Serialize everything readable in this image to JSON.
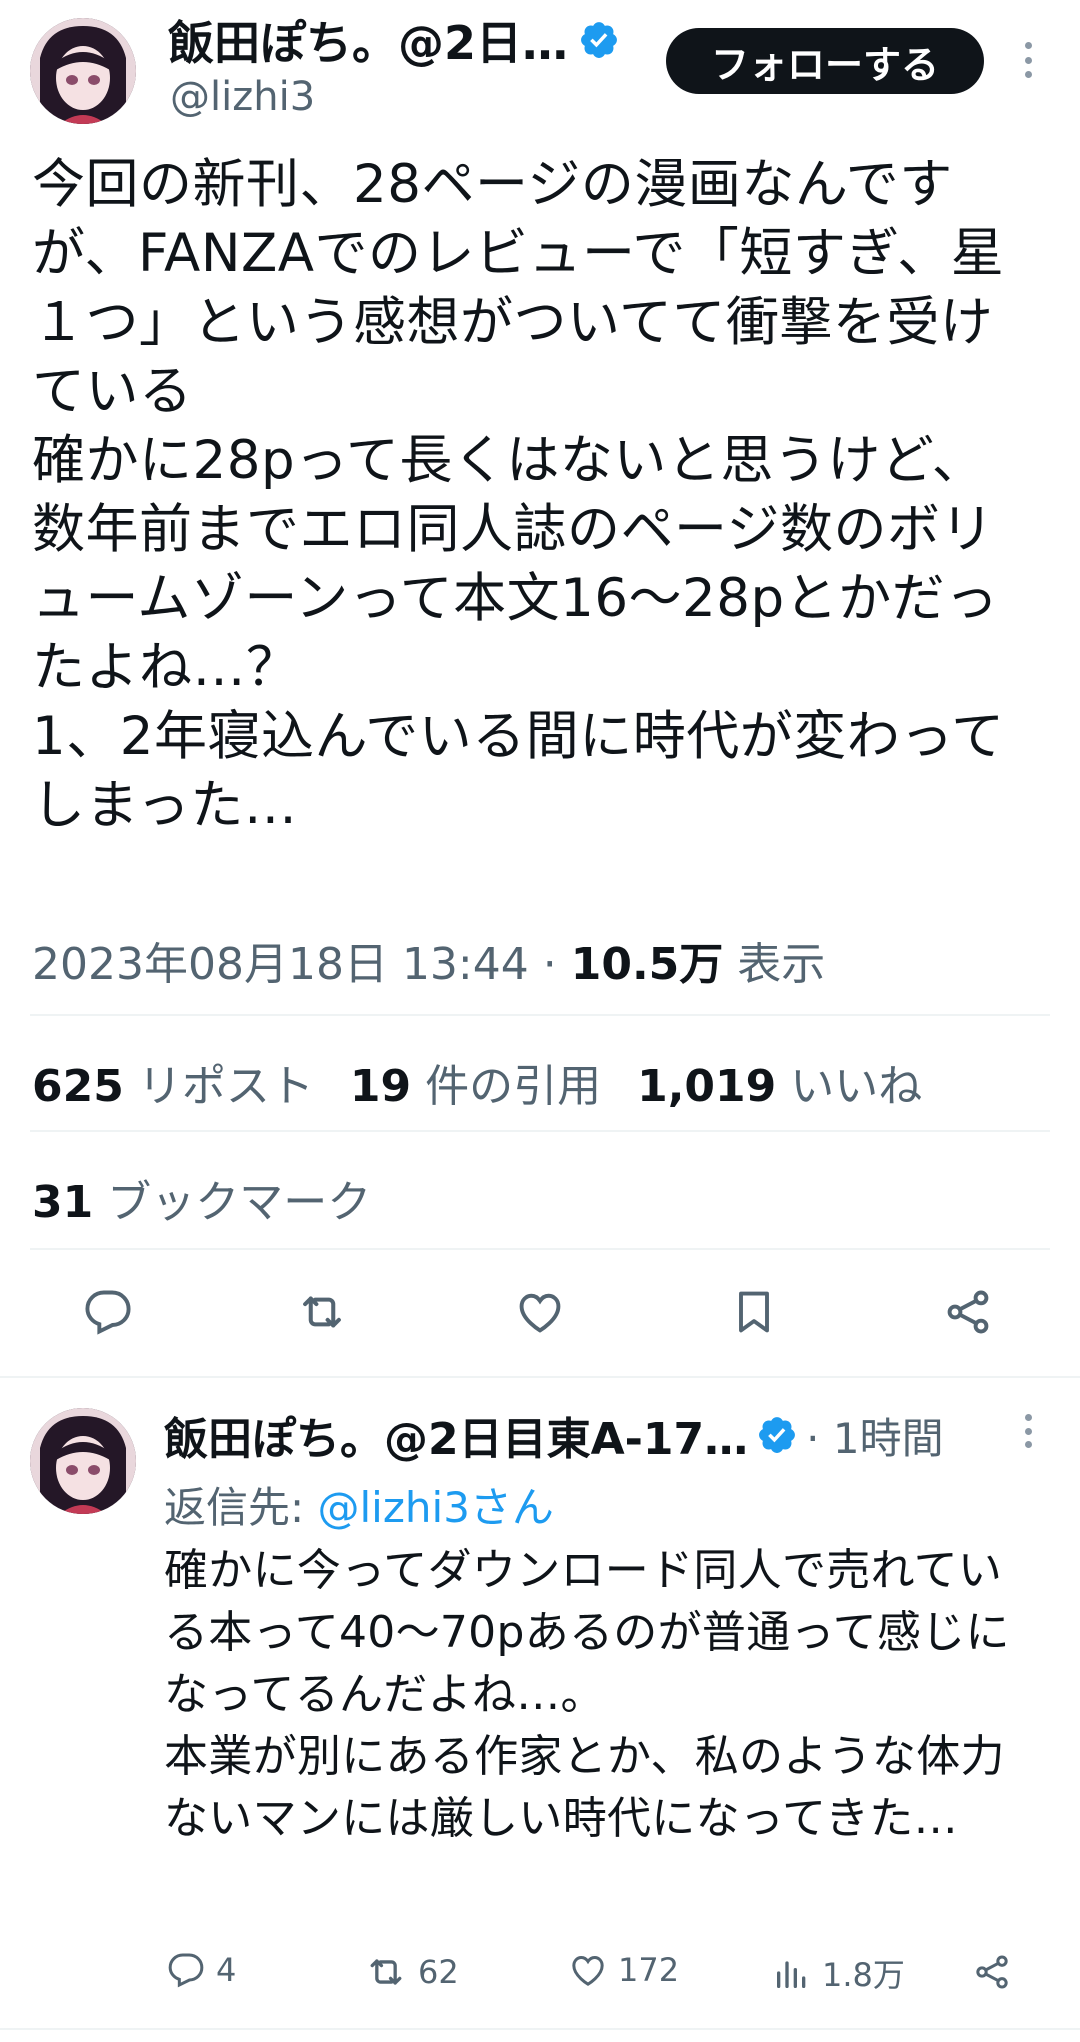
{
  "tweet": {
    "author_name": "飯田ぽち。@2日…",
    "author_handle": "@lizhi3",
    "follow_label": "フォローする",
    "text": "今回の新刊、28ページの漫画なんですが、FANZAでのレビューで「短すぎ、星１つ」という感想がついてて衝撃を受けている\n確かに28pって長くはないと思うけど、数年前までエロ同人誌のページ数のボリュームゾーンって本文16〜28pとかだったよね…？\n1、2年寝込んでいる間に時代が変わってしまった…",
    "datetime": "2023年08月18日 13:44",
    "views_count": "10.5万",
    "views_label": "表示",
    "reposts_count": "625",
    "reposts_label": "リポスト",
    "quotes_count": "19",
    "quotes_label": "件の引用",
    "likes_count": "1,019",
    "likes_label": "いいね",
    "bookmarks_count": "31",
    "bookmarks_label": "ブックマーク"
  },
  "reply": {
    "author_name": "飯田ぽち。@2日目東A-17…",
    "time": "· 1時間",
    "reply_to_prefix": "返信先: ",
    "reply_to_handle": "@lizhi3さん",
    "text": "確かに今ってダウンロード同人で売れている本って40〜70pあるのが普通って感じになってるんだよね…。\n本業が別にある作家とか、私のような体力ないマンには厳しい時代になってきた…",
    "replies": "4",
    "retweets": "62",
    "likes": "172",
    "views": "1.8万"
  },
  "icons": [
    "reply-icon",
    "retweet-icon",
    "like-icon",
    "bookmark-icon",
    "share-icon",
    "views-icon",
    "verified-icon",
    "more-icon"
  ],
  "colors": {
    "accent": "#1d9bf0",
    "text": "#0f1419",
    "muted": "#536471",
    "divider": "#eff3f4"
  }
}
